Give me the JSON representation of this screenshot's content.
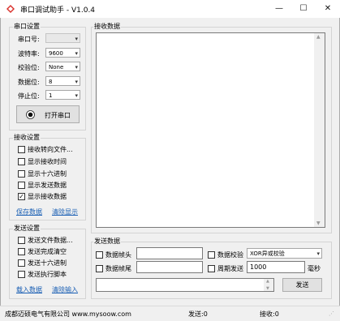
{
  "window": {
    "title": "串口调试助手 - V1.0.4",
    "controls": {
      "minimize": "—",
      "maximize": "☐",
      "close": "✕"
    }
  },
  "serial_settings": {
    "title": "串口设置",
    "port_label": "串口号:",
    "port_value": "",
    "baud_label": "波特率:",
    "baud_value": "9600",
    "parity_label": "校验位:",
    "parity_value": "None",
    "databits_label": "数据位:",
    "databits_value": "8",
    "stopbits_label": "停止位:",
    "stopbits_value": "1",
    "open_button": "打开串口"
  },
  "receive_settings": {
    "title": "接收设置",
    "options": [
      {
        "label": "接收转向文件...",
        "checked": false
      },
      {
        "label": "显示接收时间",
        "checked": false
      },
      {
        "label": "显示十六进制",
        "checked": false
      },
      {
        "label": "显示发送数据",
        "checked": false
      },
      {
        "label": "显示接收数据",
        "checked": true
      }
    ],
    "save_link": "保存数据",
    "clear_link": "清除显示"
  },
  "send_settings": {
    "title": "发送设置",
    "options": [
      {
        "label": "发送文件数据...",
        "checked": false
      },
      {
        "label": "发送完成清空",
        "checked": false
      },
      {
        "label": "发送十六进制",
        "checked": false
      },
      {
        "label": "发送执行脚本",
        "checked": false
      }
    ],
    "load_link": "载入数据",
    "clear_link": "清除输入"
  },
  "receive_data": {
    "title": "接收数据",
    "content": ""
  },
  "send_data": {
    "title": "发送数据",
    "header_label": "数据帧头",
    "header_value": "",
    "tail_label": "数据帧尾",
    "tail_value": "",
    "checksum_label": "数据校验",
    "checksum_value": "XOR异或校验",
    "period_label": "周期发送",
    "period_value": "1000",
    "period_unit": "毫秒",
    "input_value": "",
    "send_button": "发送"
  },
  "status": {
    "company": "成都迈硕电气有限公司 www.mysoow.com",
    "sent": "发送:0",
    "received": "接收:0"
  },
  "colors": {
    "link": "#1a5fb4",
    "icon_red": "#d9302b"
  }
}
